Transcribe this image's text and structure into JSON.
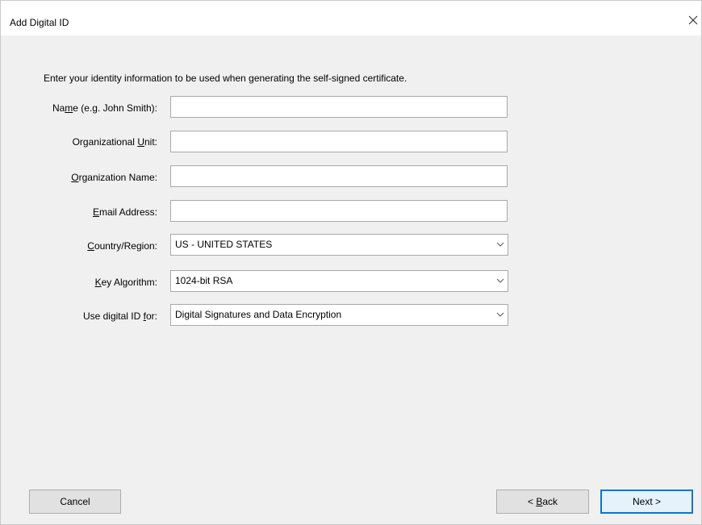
{
  "window": {
    "title": "Add Digital ID",
    "close_icon": "close-icon"
  },
  "form": {
    "intro": "Enter your identity information to be used when generating the self-signed certificate.",
    "name": {
      "pre": "Na",
      "access": "m",
      "post": "e (e.g. John Smith):",
      "value": ""
    },
    "org_unit": {
      "pre": "Organizational ",
      "access": "U",
      "post": "nit:",
      "value": ""
    },
    "org_name": {
      "pre": "",
      "access": "O",
      "post": "rganization Name:",
      "value": ""
    },
    "email": {
      "pre": "",
      "access": "E",
      "post": "mail Address:",
      "value": ""
    },
    "country": {
      "pre": "",
      "access": "C",
      "post": "ountry/Region:",
      "selected": "US - UNITED STATES"
    },
    "key_algorithm": {
      "pre": "",
      "access": "K",
      "post": "ey Algorithm:",
      "selected": "1024-bit RSA"
    },
    "use_for": {
      "pre": "Use digital ID ",
      "access": "f",
      "post": "or:",
      "selected": "Digital Signatures and Data Encryption"
    }
  },
  "buttons": {
    "cancel": "Cancel",
    "back_pre": "< ",
    "back_access": "B",
    "back_post": "ack",
    "next": "Next >"
  },
  "colors": {
    "dialog_bg": "#f0f0f0",
    "title_bg": "#ffffff",
    "accent": "#0078d7"
  }
}
